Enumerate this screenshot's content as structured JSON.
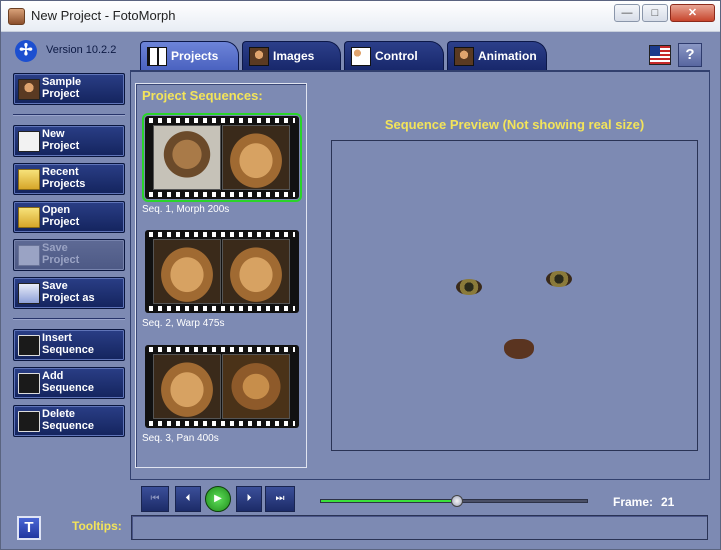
{
  "window": {
    "title": "New Project - FotoMorph",
    "controls": {
      "minimize": "—",
      "maximize": "□",
      "close": "✕"
    }
  },
  "app": {
    "version": "Version 10.2.2",
    "logo_glyph": "✢",
    "help_label": "?",
    "tooltip_toggle_label": "T"
  },
  "tabs": [
    {
      "label": "Projects",
      "active": true,
      "icon": "grid-icon"
    },
    {
      "label": "Images",
      "active": false,
      "icon": "portrait-icon"
    },
    {
      "label": "Control",
      "active": false,
      "icon": "control-icon"
    },
    {
      "label": "Animation",
      "active": false,
      "icon": "film-icon"
    }
  ],
  "sidebar": {
    "items": [
      {
        "label": "Sample\nProject",
        "icon": "portrait-icon",
        "enabled": true
      },
      {
        "label": "New\nProject",
        "icon": "new-document-icon",
        "enabled": true
      },
      {
        "label": "Recent\nProjects",
        "icon": "folder-icon",
        "enabled": true
      },
      {
        "label": "Open\nProject",
        "icon": "open-folder-icon",
        "enabled": true
      },
      {
        "label": "Save\nProject",
        "icon": "save-icon",
        "enabled": false
      },
      {
        "label": "Save\nProject as",
        "icon": "save-as-icon",
        "enabled": true
      },
      {
        "label": "Insert\nSequence",
        "icon": "insert-icon",
        "enabled": true
      },
      {
        "label": "Add\nSequence",
        "icon": "add-icon",
        "enabled": true
      },
      {
        "label": "Delete\nSequence",
        "icon": "delete-icon",
        "enabled": true
      }
    ]
  },
  "sequences": {
    "title": "Project Sequences:",
    "items": [
      {
        "caption": "Seq. 1,  Morph 200s",
        "selected": true
      },
      {
        "caption": "Seq. 2,  Warp 475s",
        "selected": false
      },
      {
        "caption": "Seq. 3,  Pan 400s",
        "selected": false
      }
    ]
  },
  "preview": {
    "title": "Sequence Preview (Not showing real size)"
  },
  "playback": {
    "first": "⏮",
    "prev": "⏴",
    "play": "▶",
    "next": "⏵",
    "last": "⏭",
    "frame_label": "Frame:",
    "frame_value": "21",
    "slider_position": 0.51
  },
  "footer": {
    "tooltips_label": "Tooltips:",
    "tooltips_text": ""
  },
  "colors": {
    "panel_bg": "#7d8ab3",
    "accent_yellow": "#f3e45a",
    "selection_green": "#2ad42a"
  }
}
